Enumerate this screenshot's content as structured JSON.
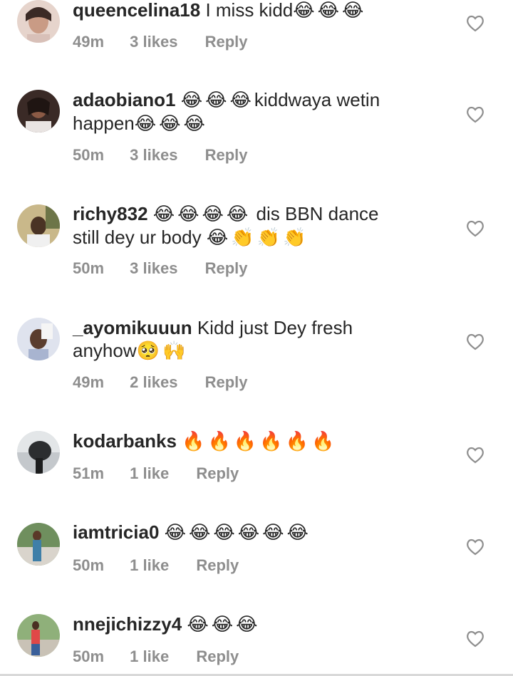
{
  "comments": [
    {
      "username": "queencelina18",
      "body": "I miss kidd",
      "emojis": "😂😂😂",
      "time": "49m",
      "likes": "3 likes",
      "reply": "Reply",
      "avatar_color": "#c7a899"
    },
    {
      "username": "adaobiano1",
      "body_line1_emojis": "😂😂😂",
      "body_line1_text": "kiddwaya wetin",
      "body_line2_text": "happen",
      "body_line2_emojis": "😂😂😂",
      "time": "50m",
      "likes": "3 likes",
      "reply": "Reply",
      "avatar_color": "#5a3f3a"
    },
    {
      "username": "richy832",
      "body_line1_emojis": "😂😂😂😂",
      "body_line1_text": "dis BBN dance",
      "body_line2_text": "still dey ur body",
      "body_line2_emojis": "😂👏👏👏",
      "time": "50m",
      "likes": "3 likes",
      "reply": "Reply",
      "avatar_color": "#8a7a55"
    },
    {
      "username": "_ayomikuuun",
      "body_line1_text": "Kidd just Dey fresh",
      "body_line2_text": "anyhow",
      "body_line2_emojis": "🥺🙌",
      "time": "49m",
      "likes": "2 likes",
      "reply": "Reply",
      "avatar_color": "#b9c2d6"
    },
    {
      "username": "kodarbanks",
      "emojis": "🔥🔥🔥🔥🔥🔥",
      "time": "51m",
      "likes": "1 like",
      "reply": "Reply",
      "avatar_color": "#9aa0a6"
    },
    {
      "username": "iamtricia0",
      "emojis": "😂😂😂😂😂😂",
      "time": "50m",
      "likes": "1 like",
      "reply": "Reply",
      "avatar_color": "#6f8f5e"
    },
    {
      "username": "nnejichizzy4",
      "emojis": "😂😂😂",
      "time": "50m",
      "likes": "1 like",
      "reply": "Reply",
      "avatar_color": "#7fa36a"
    }
  ],
  "colors": {
    "text": "#262626",
    "meta": "#8e8e8e",
    "heart": "#8e8e8e"
  },
  "icons": {
    "like": "heart-outline-icon",
    "emoji_laugh": "face-with-tears-of-joy-icon",
    "emoji_clap": "clapping-hands-icon",
    "emoji_pleading": "pleading-face-icon",
    "emoji_raise": "raising-hands-icon",
    "emoji_fire": "fire-icon"
  }
}
